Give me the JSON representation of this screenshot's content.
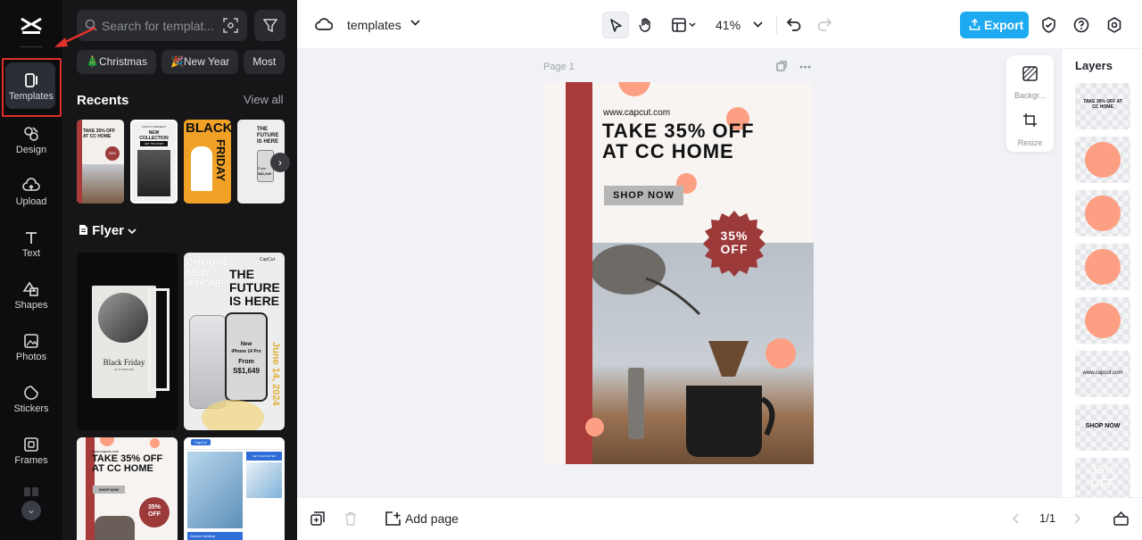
{
  "rail": {
    "items": [
      {
        "label": "Templates",
        "icon": "templates-icon"
      },
      {
        "label": "Design",
        "icon": "design-icon"
      },
      {
        "label": "Upload",
        "icon": "upload-cloud-icon"
      },
      {
        "label": "Text",
        "icon": "text-icon"
      },
      {
        "label": "Shapes",
        "icon": "shapes-icon"
      },
      {
        "label": "Photos",
        "icon": "photo-icon"
      },
      {
        "label": "Stickers",
        "icon": "sticker-icon"
      },
      {
        "label": "Frames",
        "icon": "frame-icon"
      }
    ],
    "highlight_color": "#e0302a"
  },
  "panel": {
    "search_placeholder": "Search for templat...",
    "chips": [
      "🎄Christmas",
      "🎉New Year",
      "Most"
    ],
    "recents_title": "Recents",
    "view_all": "View all",
    "recents": [
      {
        "lines": [
          "TAKE 35% OFF",
          "AT CC HOME"
        ],
        "badge": "35%"
      },
      {
        "lines": [
          "CAPCUT PRESENT",
          "NEW COLLECTION",
          "GET 75% NOW!"
        ]
      },
      {
        "lines": [
          "BLACK",
          "FRIDAY"
        ]
      },
      {
        "lines": [
          "THE",
          "FUTURE",
          "IS HERE",
          "From",
          "S$1,649"
        ]
      }
    ],
    "flyer_title": "Flyer",
    "flyers": [
      {
        "title": "Black Friday",
        "sub": "UP TO 50% OFF"
      },
      {
        "brand": "CapCut",
        "lines": [
          "THE",
          "FUTURE",
          "IS HERE"
        ],
        "bg_text": "CHOOSE NEW IPHONE",
        "phone": [
          "New",
          "iPhone 14 Pro",
          "From",
          "S$1,649"
        ],
        "side": "June 14, 2024"
      },
      {
        "lines": [
          "TAKE 35% OFF",
          "AT CC HOME"
        ],
        "url": "www.capcut.com",
        "button": "SHOP NOW",
        "badge": [
          "35%",
          "OFF"
        ]
      },
      {
        "brand": "CapCut",
        "tag": "GET VACCINATED",
        "caption": "Service Medical"
      }
    ]
  },
  "topbar": {
    "project_name": "templates",
    "zoom": "41%",
    "export_label": "Export",
    "accent": "#1eaaf1"
  },
  "canvas": {
    "page_label": "Page 1",
    "side_tools": [
      "Backgr...",
      "Resize"
    ],
    "design": {
      "url": "www.capcut.com",
      "headline": [
        "TAKE 35% OFF",
        "AT CC HOME"
      ],
      "button": "SHOP NOW",
      "badge": [
        "35%",
        "OFF"
      ],
      "colors": {
        "stripe": "#a93a3a",
        "dot": "#fd9f82",
        "badge": "#9c3a3a"
      }
    }
  },
  "layers": {
    "title": "Layers",
    "items": [
      {
        "kind": "text",
        "text": "TAKE 35% OFF AT CC HOME"
      },
      {
        "kind": "circle"
      },
      {
        "kind": "circle"
      },
      {
        "kind": "circle"
      },
      {
        "kind": "circle"
      },
      {
        "kind": "text",
        "text": "www.capcut.com"
      },
      {
        "kind": "text",
        "text": "SHOP NOW"
      },
      {
        "kind": "text",
        "text": "35% OFF"
      }
    ]
  },
  "bottombar": {
    "add_page": "Add page",
    "page_count": "1/1"
  }
}
